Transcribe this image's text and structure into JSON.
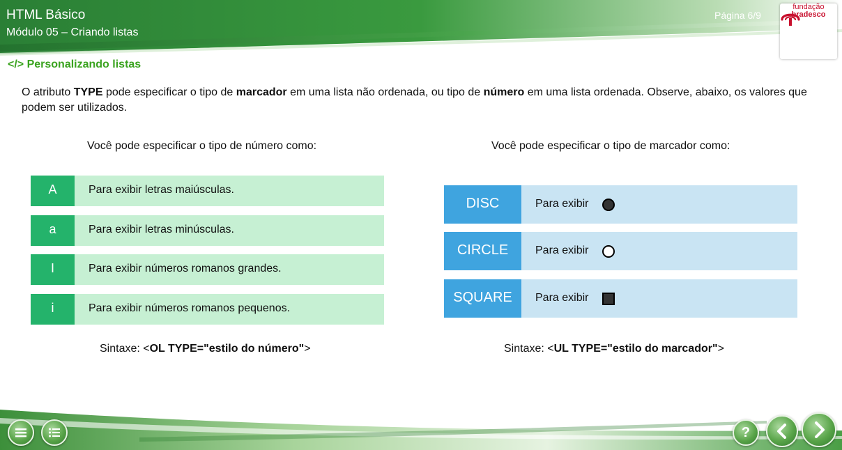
{
  "header": {
    "course_title": "HTML Básico",
    "module_title": "Módulo 05 – Criando listas",
    "page_indicator": "Página 6/9",
    "logo_line1": "fundação",
    "logo_line2": "bradesco"
  },
  "section_title": "</> Personalizando listas",
  "intro": {
    "p1": "O atributo ",
    "b1": "TYPE",
    "p2": " pode especificar o tipo de  ",
    "b2": "marcador",
    "p3": " em uma lista não ordenada, ou tipo de ",
    "b3": "número",
    "p4": " em uma lista ordenada. Observe, abaixo, os valores que podem ser utilizados."
  },
  "number_section": {
    "title": "Você pode especificar o tipo de número como:",
    "items": [
      {
        "key": "A",
        "desc": "Para exibir letras maiúsculas."
      },
      {
        "key": "a",
        "desc": "Para exibir letras minúsculas."
      },
      {
        "key": "I",
        "desc": "Para exibir números romanos grandes."
      },
      {
        "key": "i",
        "desc": "Para exibir números romanos pequenos."
      }
    ],
    "syntax_prefix": "Sintaxe: <",
    "syntax_bold1": "OL TYPE=\"",
    "syntax_bold2": "estilo do número",
    "syntax_mid": "\"",
    "syntax_suffix": ">"
  },
  "marker_section": {
    "title": "Você pode especificar o tipo de marcador como:",
    "items": [
      {
        "key": "DISC",
        "desc": "Para exibir",
        "symbol": "filled-circle-icon"
      },
      {
        "key": "CIRCLE",
        "desc": "Para exibir",
        "symbol": "hollow-circle-icon"
      },
      {
        "key": "SQUARE",
        "desc": "Para exibir",
        "symbol": "filled-square-icon"
      }
    ],
    "syntax_prefix": "Sintaxe: <",
    "syntax_bold1": "UL TYPE=\"",
    "syntax_bold2": "estilo do marcador",
    "syntax_mid": "\"",
    "syntax_suffix": ">"
  },
  "footer": {
    "buttons": [
      "menu-icon",
      "list-icon",
      "help-icon",
      "previous-icon",
      "next-icon"
    ],
    "help_label": "?"
  },
  "colors": {
    "header_green": "#2e8b3a",
    "section_title": "#3aa31f",
    "number_key_bg": "#24b36b",
    "number_row_bg": "#c6f0d3",
    "marker_key_bg": "#3fa4df",
    "marker_row_bg": "#c9e4f3",
    "logo_red": "#c8102e"
  }
}
